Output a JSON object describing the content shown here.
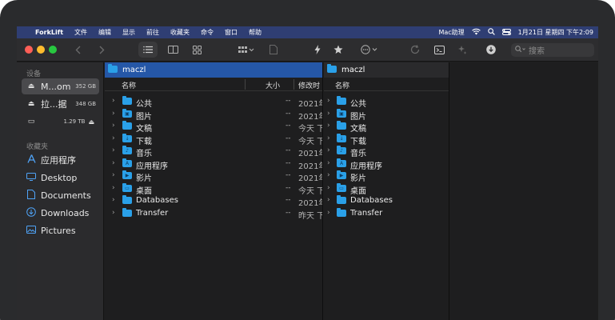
{
  "menubar": {
    "apple_glyph": "",
    "app_name": "ForkLift",
    "menus": [
      "文件",
      "编辑",
      "显示",
      "前往",
      "收藏夹",
      "命令",
      "窗口",
      "帮助"
    ],
    "right": {
      "assistant": "Mac助理",
      "datetime": "1月21日 星期四 下午2:09"
    }
  },
  "toolbar": {
    "search_placeholder": "搜索"
  },
  "sidebar": {
    "devices_title": "设备",
    "devices": [
      {
        "label": "M...om",
        "size": "352 GB"
      },
      {
        "label": "拉...据",
        "size": "348 GB"
      },
      {
        "label": "",
        "size": "1.29 TB"
      }
    ],
    "favorites_title": "收藏夹",
    "favorites": [
      {
        "label": "应用程序",
        "icon": "apps-icon"
      },
      {
        "label": "Desktop",
        "icon": "desktop-icon"
      },
      {
        "label": "Documents",
        "icon": "document-icon"
      },
      {
        "label": "Downloads",
        "icon": "download-icon"
      },
      {
        "label": "Pictures",
        "icon": "pictures-icon"
      }
    ]
  },
  "left_pane": {
    "path": "maczl",
    "col_name": "名称",
    "col_size": "大小",
    "col_modified": "修改时",
    "rows": [
      {
        "name": "公共",
        "size": "--",
        "modified": "2021年"
      },
      {
        "name": "图片",
        "size": "--",
        "modified": "2021年"
      },
      {
        "name": "文稿",
        "size": "--",
        "modified": "今天 下"
      },
      {
        "name": "下载",
        "size": "--",
        "modified": "今天 下"
      },
      {
        "name": "音乐",
        "size": "--",
        "modified": "2021年"
      },
      {
        "name": "应用程序",
        "size": "--",
        "modified": "2021年"
      },
      {
        "name": "影片",
        "size": "--",
        "modified": "2021年"
      },
      {
        "name": "桌面",
        "size": "--",
        "modified": "今天 下"
      },
      {
        "name": "Databases",
        "size": "--",
        "modified": "2021年"
      },
      {
        "name": "Transfer",
        "size": "--",
        "modified": "昨天 下"
      }
    ]
  },
  "right_pane": {
    "path": "maczl",
    "col_name": "名称",
    "rows": [
      "公共",
      "图片",
      "文稿",
      "下载",
      "音乐",
      "应用程序",
      "影片",
      "桌面",
      "Databases",
      "Transfer"
    ]
  },
  "colors": {
    "menubar": "#2f3e73",
    "active_path_bar": "#2557a7",
    "folder": "#2aa0e8",
    "sidebar_icon": "#4fa3f7"
  }
}
